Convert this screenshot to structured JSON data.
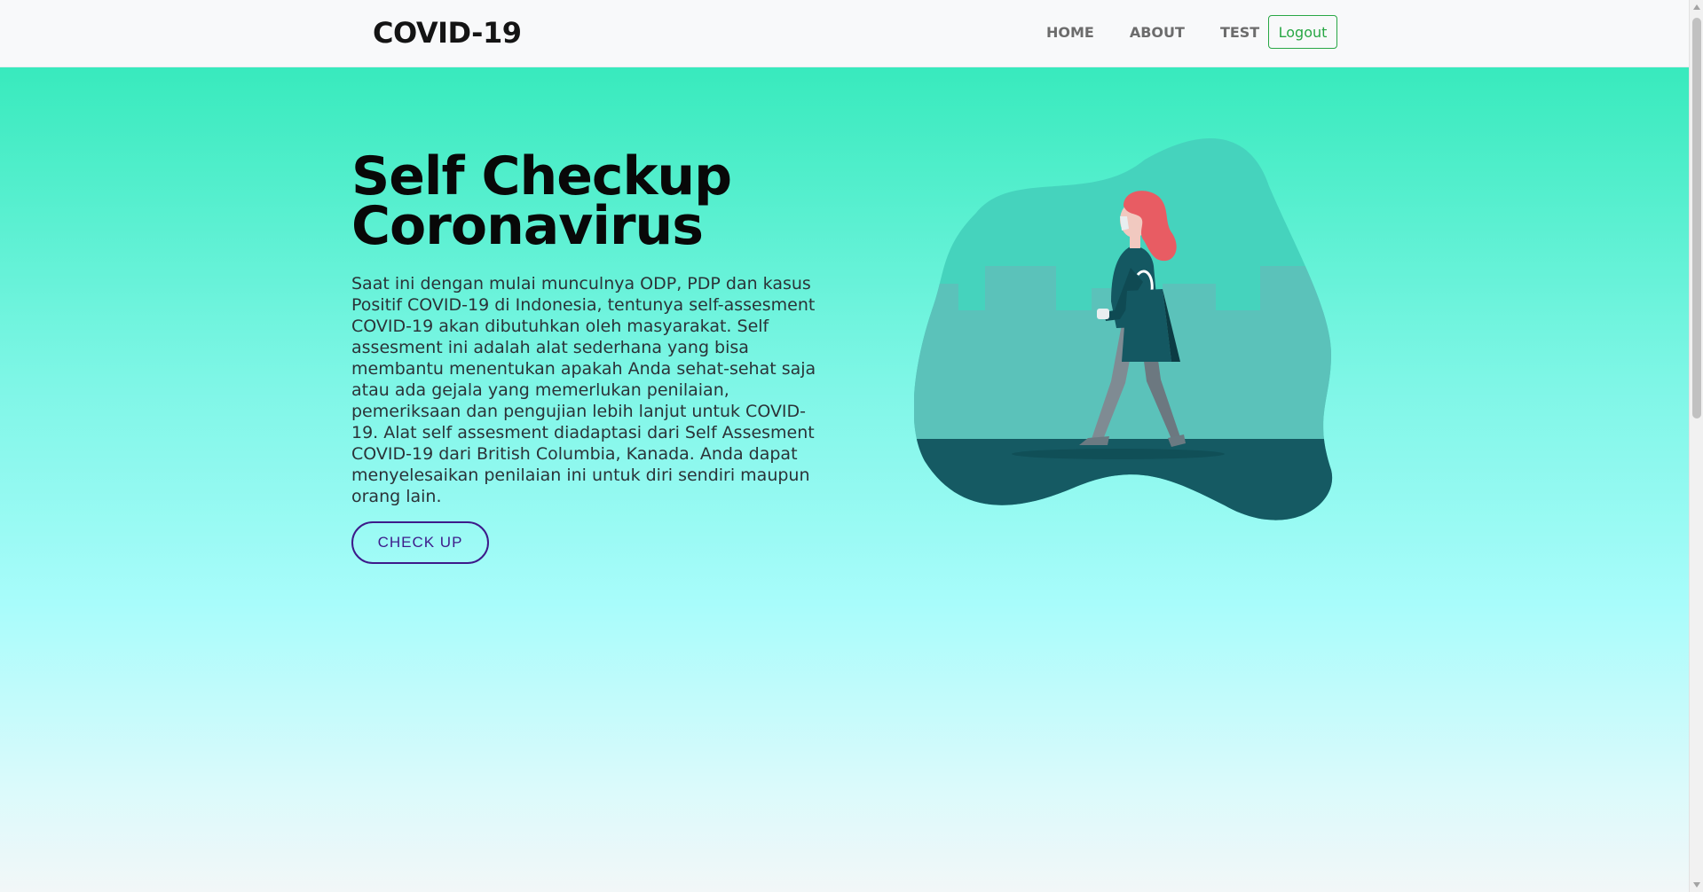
{
  "navbar": {
    "brand": "COVID-19",
    "links": [
      "HOME",
      "ABOUT",
      "TEST"
    ],
    "logout_label": "Logout"
  },
  "hero": {
    "title_line1": "Self Checkup",
    "title_line2": "Coronavirus",
    "description": "Saat ini dengan mulai munculnya ODP, PDP dan kasus Positif COVID-19 di Indonesia, tentunya self-assesment COVID-19 akan dibutuhkan oleh masyarakat. Self assesment ini adalah alat sederhana yang bisa membantu menentukan apakah Anda sehat-sehat saja atau ada gejala yang memerlukan penilaian, pemeriksaan dan pengujian lebih lanjut untuk COVID-19. Alat self assesment diadaptasi dari Self Assesment COVID-19 dari British Columbia, Kanada. Anda dapat menyelesaikan penilaian ini untuk diri sendiri maupun orang lain.",
    "button_label": "CHECK UP"
  },
  "illustration": {
    "icon": "woman-walking-with-mask-illustration",
    "colors": {
      "blob": "#45d3bd",
      "buildings": "#5bc2ba",
      "ground": "#155a63",
      "hair": "#e85c63",
      "coat": "#145862"
    }
  },
  "colors": {
    "gradient_top": "#38eabd",
    "gradient_mid": "#a8fcfb",
    "button_accent": "#3d1a8a",
    "logout_accent": "#28a745"
  }
}
